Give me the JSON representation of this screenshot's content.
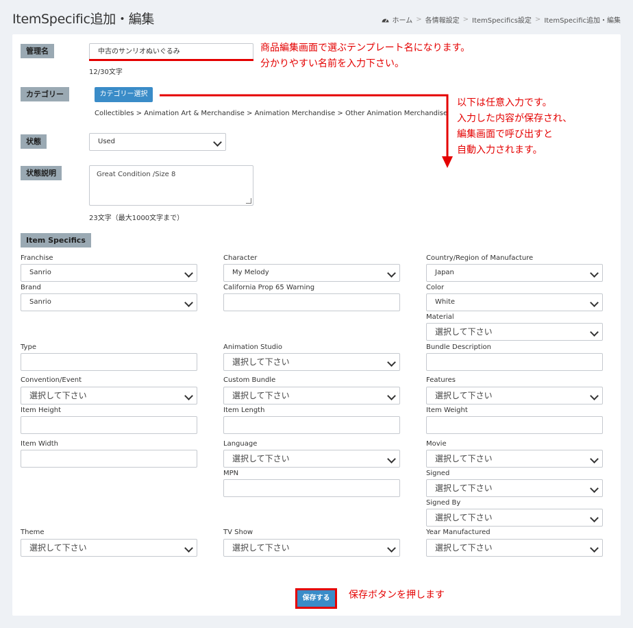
{
  "page": {
    "title": "ItemSpecific追加・編集"
  },
  "breadcrumb": {
    "home": "ホーム",
    "items": [
      "各情報設定",
      "ItemSpecifics設定",
      "ItemSpecific追加・編集"
    ],
    "separator": ">"
  },
  "form": {
    "name": {
      "label": "管理名",
      "value": "中古のサンリオぬいぐるみ",
      "counter": "12/30文字"
    },
    "category": {
      "label": "カテゴリー",
      "button": "カテゴリー選択",
      "path": "Collectibles > Animation Art & Merchandise > Animation Merchandise > Other Animation Merchandise"
    },
    "condition": {
      "label": "状態",
      "value": "Used"
    },
    "condition_desc": {
      "label": "状態説明",
      "value": "Great Condition /Size 8",
      "counter": "23文字（最大1000文字まで）"
    },
    "item_specifics_label": "Item Specifics",
    "fields": {
      "franchise": {
        "label": "Franchise",
        "value": "Sanrio"
      },
      "character": {
        "label": "Character",
        "value": "My Melody"
      },
      "country": {
        "label": "Country/Region of Manufacture",
        "value": "Japan"
      },
      "brand": {
        "label": "Brand",
        "value": "Sanrio"
      },
      "prop65": {
        "label": "California Prop 65 Warning",
        "value": ""
      },
      "color": {
        "label": "Color",
        "value": "White"
      },
      "material": {
        "label": "Material",
        "value": "選択して下さい"
      },
      "type": {
        "label": "Type",
        "value": ""
      },
      "animation_studio": {
        "label": "Animation Studio",
        "value": "選択して下さい"
      },
      "bundle_desc": {
        "label": "Bundle Description",
        "value": ""
      },
      "convention": {
        "label": "Convention/Event",
        "value": "選択して下さい"
      },
      "custom_bundle": {
        "label": "Custom Bundle",
        "value": "選択して下さい"
      },
      "features": {
        "label": "Features",
        "value": "選択して下さい"
      },
      "item_height": {
        "label": "Item Height",
        "value": ""
      },
      "item_length": {
        "label": "Item Length",
        "value": ""
      },
      "item_weight": {
        "label": "Item Weight",
        "value": ""
      },
      "item_width": {
        "label": "Item Width",
        "value": ""
      },
      "language": {
        "label": "Language",
        "value": "選択して下さい"
      },
      "movie": {
        "label": "Movie",
        "value": "選択して下さい"
      },
      "mpn": {
        "label": "MPN",
        "value": ""
      },
      "signed": {
        "label": "Signed",
        "value": "選択して下さい"
      },
      "signed_by": {
        "label": "Signed By",
        "value": "選択して下さい"
      },
      "theme": {
        "label": "Theme",
        "value": "選択して下さい"
      },
      "tv_show": {
        "label": "TV Show",
        "value": "選択して下さい"
      },
      "year": {
        "label": "Year Manufactured",
        "value": "選択して下さい"
      }
    },
    "save_button": "保存する"
  },
  "annotations": {
    "name_note_1": "商品編集画面で選ぶテンプレート名になります。",
    "name_note_2": "分かりやすい名前を入力下さい。",
    "optional_1": "以下は任意入力です。",
    "optional_2": "入力した内容が保存され、",
    "optional_3": "編集画面で呼び出すと",
    "optional_4": "自動入力されます。",
    "save_note": "保存ボタンを押します"
  },
  "colors": {
    "accent": "#3a8cc8",
    "annotation": "#e40000",
    "label_bg": "#9aa9b3",
    "page_bg": "#eef1f5"
  }
}
